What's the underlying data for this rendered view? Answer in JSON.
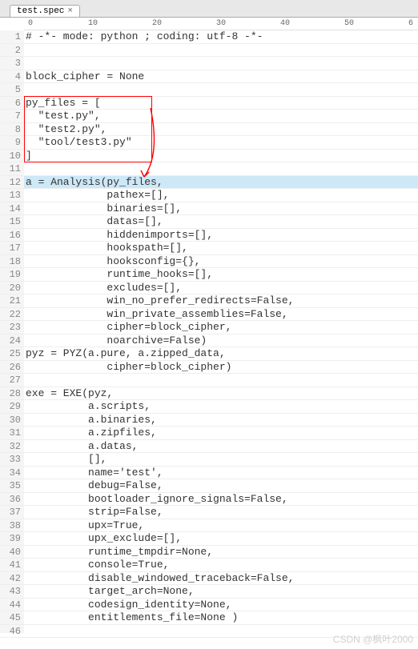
{
  "tab": {
    "name": "test.spec",
    "close": "×"
  },
  "ruler": {
    "marks": [
      "0",
      "10",
      "20",
      "30",
      "40",
      "50",
      "6"
    ]
  },
  "code": {
    "lines": [
      "# -*- mode: python ; coding: utf-8 -*-",
      "",
      "",
      "block_cipher = None",
      "",
      "py_files = [",
      "  \"test.py\",",
      "  \"test2.py\",",
      "  \"tool/test3.py\"",
      "]",
      "",
      "a = Analysis(py_files,",
      "             pathex=[],",
      "             binaries=[],",
      "             datas=[],",
      "             hiddenimports=[],",
      "             hookspath=[],",
      "             hooksconfig={},",
      "             runtime_hooks=[],",
      "             excludes=[],",
      "             win_no_prefer_redirects=False,",
      "             win_private_assemblies=False,",
      "             cipher=block_cipher,",
      "             noarchive=False)",
      "pyz = PYZ(a.pure, a.zipped_data,",
      "             cipher=block_cipher)",
      "",
      "exe = EXE(pyz,",
      "          a.scripts,",
      "          a.binaries,",
      "          a.zipfiles,",
      "          a.datas,",
      "          [],",
      "          name='test',",
      "          debug=False,",
      "          bootloader_ignore_signals=False,",
      "          strip=False,",
      "          upx=True,",
      "          upx_exclude=[],",
      "          runtime_tmpdir=None,",
      "          console=True,",
      "          disable_windowed_traceback=False,",
      "          target_arch=None,",
      "          codesign_identity=None,",
      "          entitlements_file=None )",
      ""
    ],
    "highlighted_line": 12
  },
  "watermark": "CSDN @枫叶2000"
}
